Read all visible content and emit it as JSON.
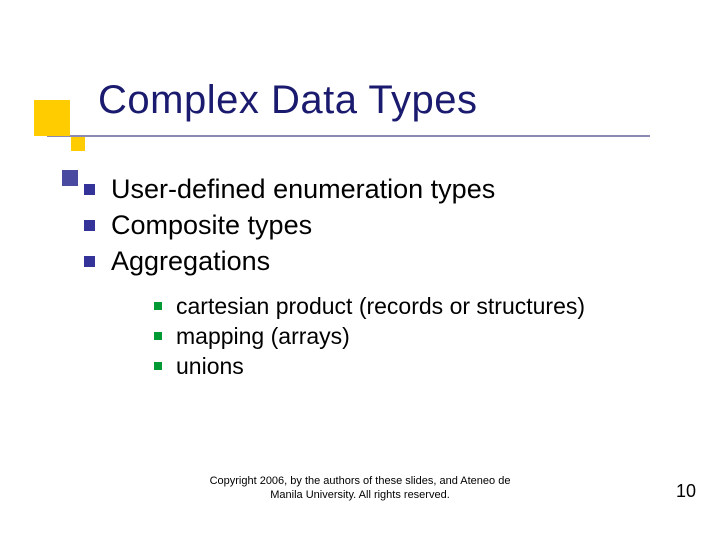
{
  "title": "Complex Data Types",
  "bullets": [
    "User-defined enumeration types",
    "Composite types",
    "Aggregations"
  ],
  "sub_bullets": [
    "cartesian product (records or structures)",
    "mapping (arrays)",
    "unions"
  ],
  "copyright_line1": "Copyright 2006, by the authors of these slides, and Ateneo de",
  "copyright_line2": "Manila University. All rights reserved.",
  "page_number": "10"
}
